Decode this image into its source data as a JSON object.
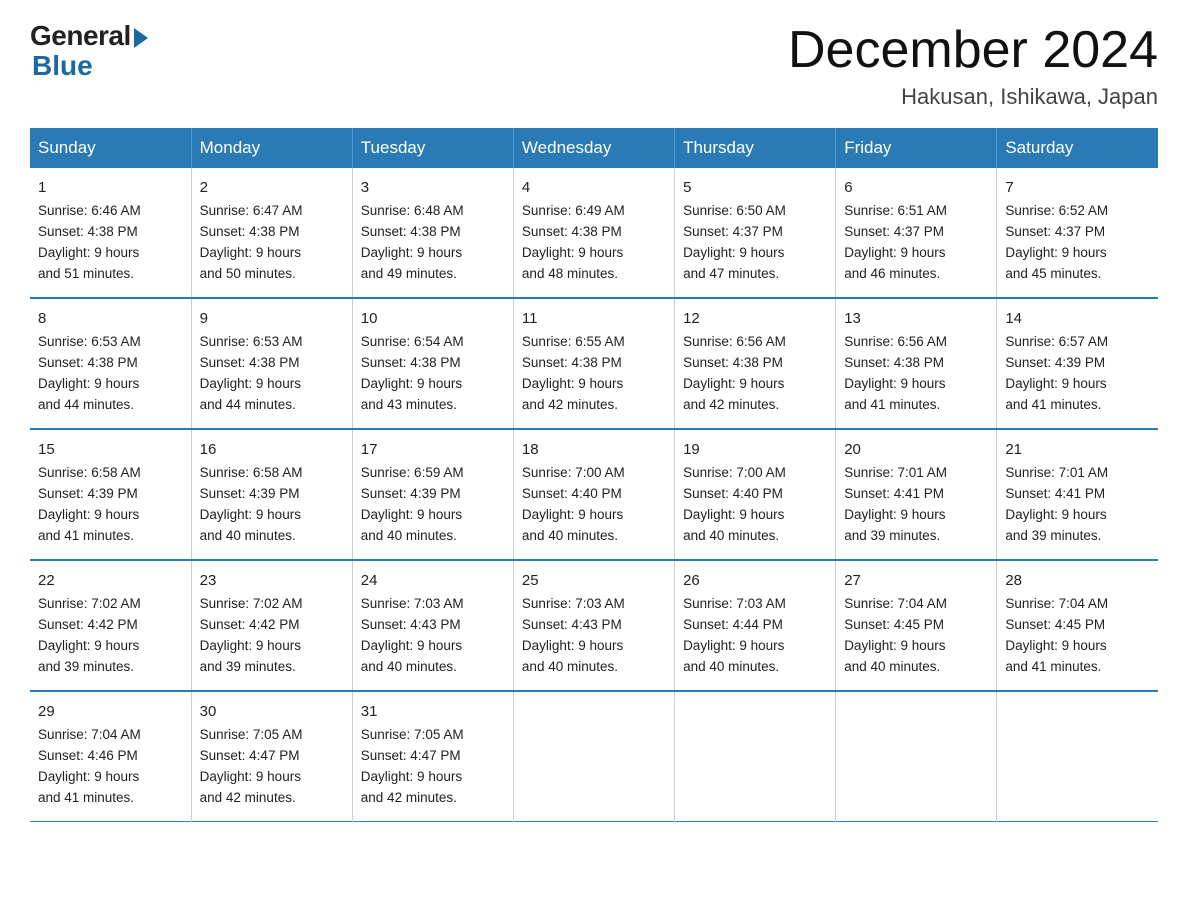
{
  "logo": {
    "general": "General",
    "blue": "Blue"
  },
  "header": {
    "month": "December 2024",
    "location": "Hakusan, Ishikawa, Japan"
  },
  "days_of_week": [
    "Sunday",
    "Monday",
    "Tuesday",
    "Wednesday",
    "Thursday",
    "Friday",
    "Saturday"
  ],
  "weeks": [
    [
      {
        "num": "1",
        "sunrise": "6:46 AM",
        "sunset": "4:38 PM",
        "daylight": "9 hours and 51 minutes."
      },
      {
        "num": "2",
        "sunrise": "6:47 AM",
        "sunset": "4:38 PM",
        "daylight": "9 hours and 50 minutes."
      },
      {
        "num": "3",
        "sunrise": "6:48 AM",
        "sunset": "4:38 PM",
        "daylight": "9 hours and 49 minutes."
      },
      {
        "num": "4",
        "sunrise": "6:49 AM",
        "sunset": "4:38 PM",
        "daylight": "9 hours and 48 minutes."
      },
      {
        "num": "5",
        "sunrise": "6:50 AM",
        "sunset": "4:37 PM",
        "daylight": "9 hours and 47 minutes."
      },
      {
        "num": "6",
        "sunrise": "6:51 AM",
        "sunset": "4:37 PM",
        "daylight": "9 hours and 46 minutes."
      },
      {
        "num": "7",
        "sunrise": "6:52 AM",
        "sunset": "4:37 PM",
        "daylight": "9 hours and 45 minutes."
      }
    ],
    [
      {
        "num": "8",
        "sunrise": "6:53 AM",
        "sunset": "4:38 PM",
        "daylight": "9 hours and 44 minutes."
      },
      {
        "num": "9",
        "sunrise": "6:53 AM",
        "sunset": "4:38 PM",
        "daylight": "9 hours and 44 minutes."
      },
      {
        "num": "10",
        "sunrise": "6:54 AM",
        "sunset": "4:38 PM",
        "daylight": "9 hours and 43 minutes."
      },
      {
        "num": "11",
        "sunrise": "6:55 AM",
        "sunset": "4:38 PM",
        "daylight": "9 hours and 42 minutes."
      },
      {
        "num": "12",
        "sunrise": "6:56 AM",
        "sunset": "4:38 PM",
        "daylight": "9 hours and 42 minutes."
      },
      {
        "num": "13",
        "sunrise": "6:56 AM",
        "sunset": "4:38 PM",
        "daylight": "9 hours and 41 minutes."
      },
      {
        "num": "14",
        "sunrise": "6:57 AM",
        "sunset": "4:39 PM",
        "daylight": "9 hours and 41 minutes."
      }
    ],
    [
      {
        "num": "15",
        "sunrise": "6:58 AM",
        "sunset": "4:39 PM",
        "daylight": "9 hours and 41 minutes."
      },
      {
        "num": "16",
        "sunrise": "6:58 AM",
        "sunset": "4:39 PM",
        "daylight": "9 hours and 40 minutes."
      },
      {
        "num": "17",
        "sunrise": "6:59 AM",
        "sunset": "4:39 PM",
        "daylight": "9 hours and 40 minutes."
      },
      {
        "num": "18",
        "sunrise": "7:00 AM",
        "sunset": "4:40 PM",
        "daylight": "9 hours and 40 minutes."
      },
      {
        "num": "19",
        "sunrise": "7:00 AM",
        "sunset": "4:40 PM",
        "daylight": "9 hours and 40 minutes."
      },
      {
        "num": "20",
        "sunrise": "7:01 AM",
        "sunset": "4:41 PM",
        "daylight": "9 hours and 39 minutes."
      },
      {
        "num": "21",
        "sunrise": "7:01 AM",
        "sunset": "4:41 PM",
        "daylight": "9 hours and 39 minutes."
      }
    ],
    [
      {
        "num": "22",
        "sunrise": "7:02 AM",
        "sunset": "4:42 PM",
        "daylight": "9 hours and 39 minutes."
      },
      {
        "num": "23",
        "sunrise": "7:02 AM",
        "sunset": "4:42 PM",
        "daylight": "9 hours and 39 minutes."
      },
      {
        "num": "24",
        "sunrise": "7:03 AM",
        "sunset": "4:43 PM",
        "daylight": "9 hours and 40 minutes."
      },
      {
        "num": "25",
        "sunrise": "7:03 AM",
        "sunset": "4:43 PM",
        "daylight": "9 hours and 40 minutes."
      },
      {
        "num": "26",
        "sunrise": "7:03 AM",
        "sunset": "4:44 PM",
        "daylight": "9 hours and 40 minutes."
      },
      {
        "num": "27",
        "sunrise": "7:04 AM",
        "sunset": "4:45 PM",
        "daylight": "9 hours and 40 minutes."
      },
      {
        "num": "28",
        "sunrise": "7:04 AM",
        "sunset": "4:45 PM",
        "daylight": "9 hours and 41 minutes."
      }
    ],
    [
      {
        "num": "29",
        "sunrise": "7:04 AM",
        "sunset": "4:46 PM",
        "daylight": "9 hours and 41 minutes."
      },
      {
        "num": "30",
        "sunrise": "7:05 AM",
        "sunset": "4:47 PM",
        "daylight": "9 hours and 42 minutes."
      },
      {
        "num": "31",
        "sunrise": "7:05 AM",
        "sunset": "4:47 PM",
        "daylight": "9 hours and 42 minutes."
      },
      null,
      null,
      null,
      null
    ]
  ],
  "labels": {
    "sunrise": "Sunrise:",
    "sunset": "Sunset:",
    "daylight": "Daylight:"
  }
}
